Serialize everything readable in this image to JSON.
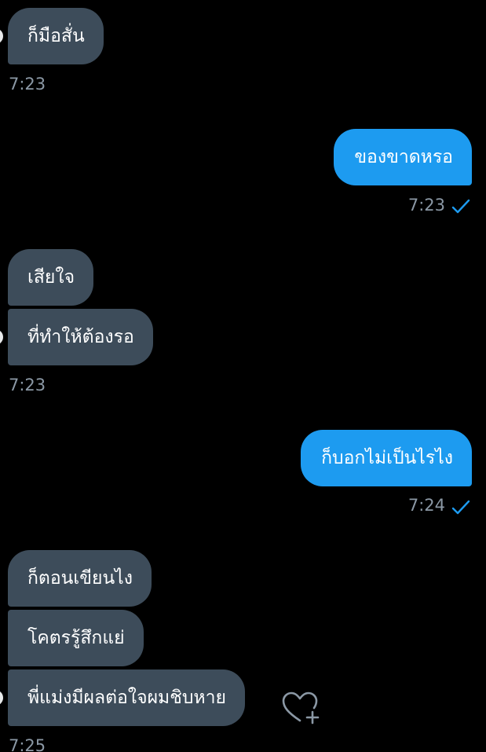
{
  "conversation": {
    "messages": [
      {
        "direction": "in",
        "text": "ก็มือสั่น"
      },
      {
        "direction": "out",
        "text": "ของขาดหรอ"
      },
      {
        "direction": "in",
        "text": "เสียใจ"
      },
      {
        "direction": "in",
        "text": "ที่ทำให้ต้องรอ"
      },
      {
        "direction": "out",
        "text": "ก็บอกไม่เป็นไรไง"
      },
      {
        "direction": "in",
        "text": "ก็ตอนเขียนไง"
      },
      {
        "direction": "in",
        "text": "โคตรรู้สึกแย่"
      },
      {
        "direction": "in",
        "text": "พี่แม่งมีผลต่อใจผมชิบหาย"
      }
    ],
    "timestamps": [
      "7:23",
      "7:23",
      "7:23",
      "7:24",
      "7:25"
    ]
  },
  "icons": {
    "read_receipt": "check-icon",
    "react": "heart-add-icon"
  },
  "colors": {
    "background": "#000000",
    "incoming_bubble": "#3d4c5a",
    "outgoing_bubble": "#1d9bf0",
    "timestamp": "#8b98a5",
    "check": "#1d9bf0"
  }
}
